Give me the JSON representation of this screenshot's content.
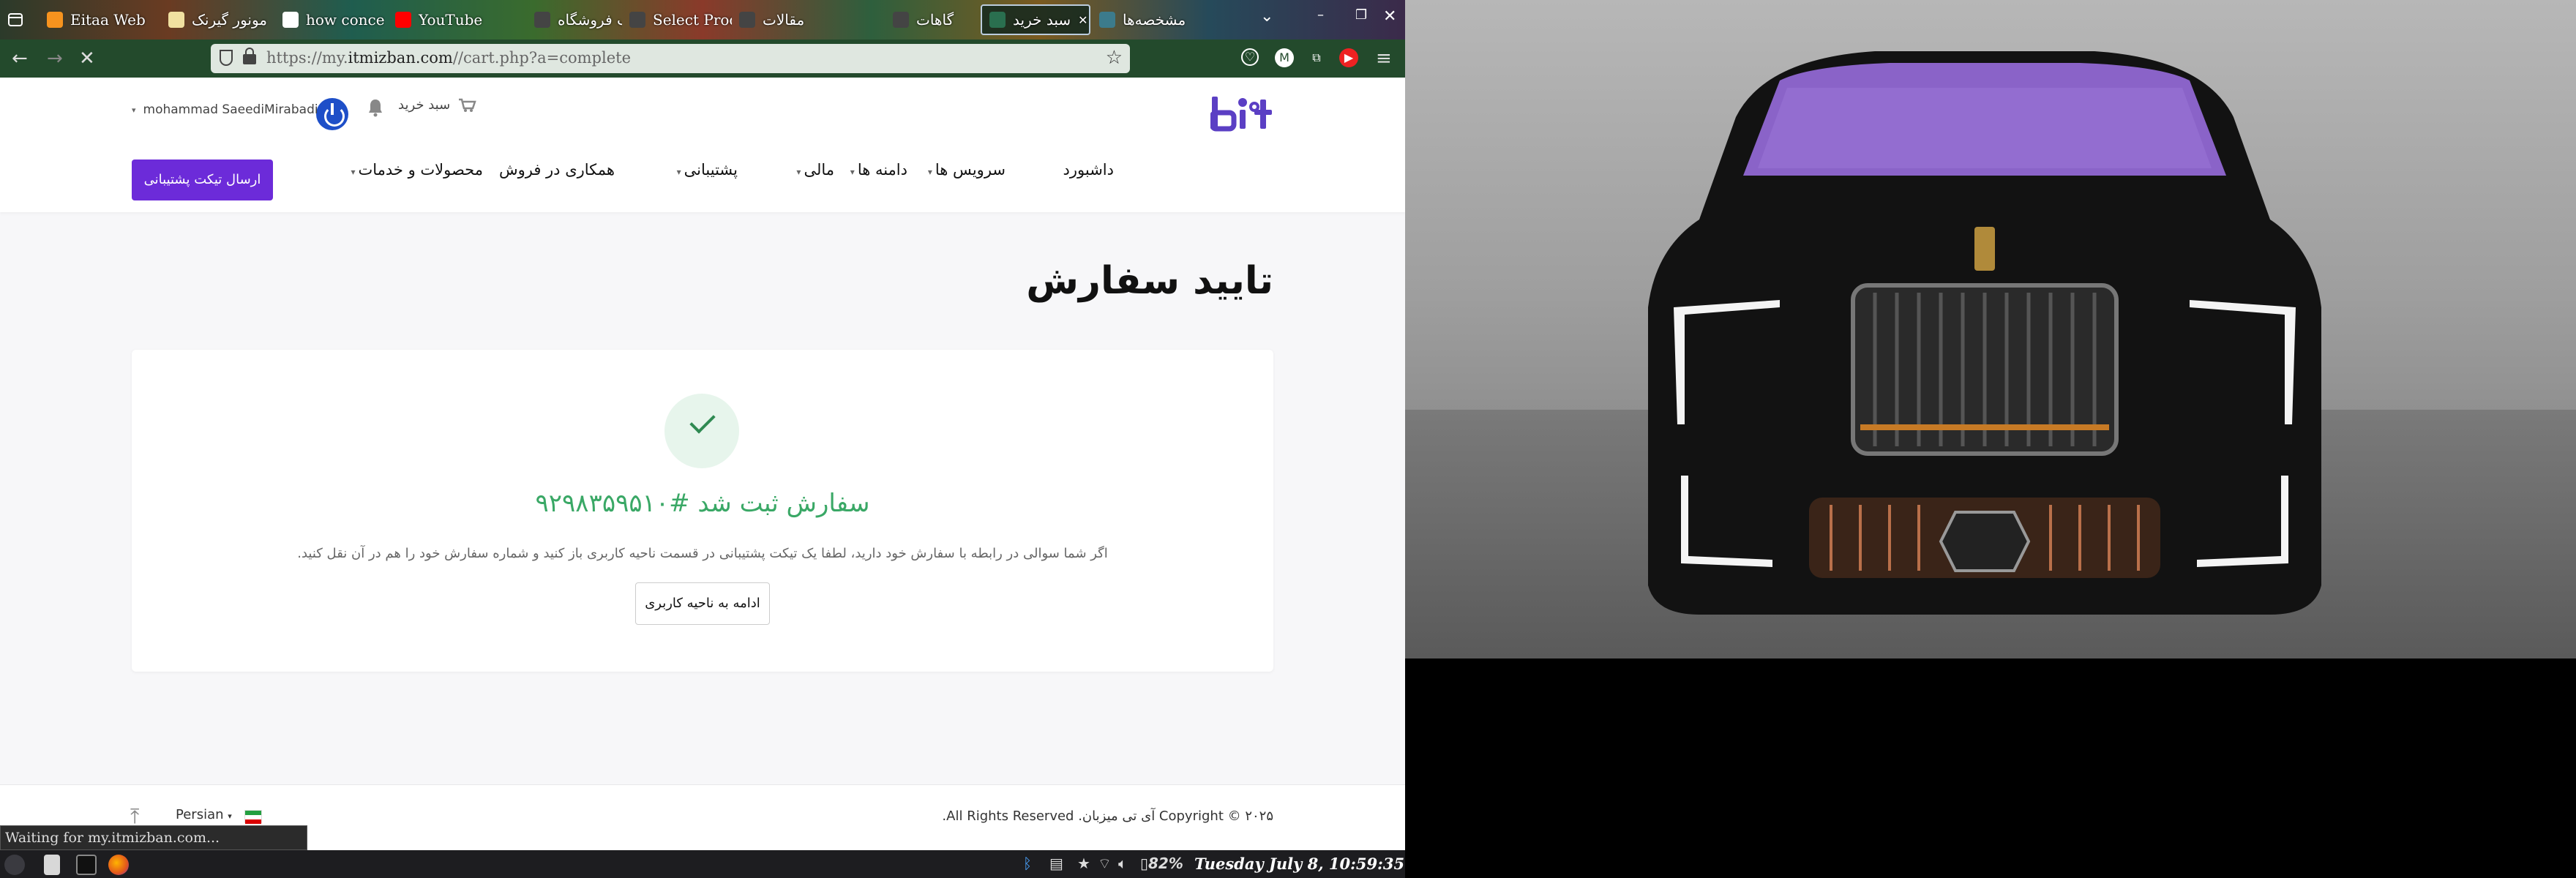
{
  "browser": {
    "tabs": [
      {
        "label": "Eitaa Web",
        "color": "#f7931e"
      },
      {
        "label": "مونور گیرنک",
        "color": "#f0e0a0"
      },
      {
        "label": "how conce",
        "color": "#ffffff"
      },
      {
        "label": "YouTube",
        "color": "#ff0000"
      },
      {
        "label": "قالب فروشگاه",
        "color": "#444444"
      },
      {
        "label": "Select Prod",
        "color": "#444444"
      },
      {
        "label": "مقالات",
        "color": "#444444"
      },
      {
        "label": "گاهات",
        "color": "#444444"
      },
      {
        "label": "سبد خرید",
        "color": "#2a6f4f",
        "active": true
      },
      {
        "label": "مشخصه‌ها",
        "color": "#3c7b8c"
      }
    ],
    "url_prefix": "https://my.",
    "url_domain": "itmizban.com",
    "url_path": "//cart.php?a=complete",
    "status_text": "Waiting for my.itmizban.com..."
  },
  "header": {
    "cart_label": "سبد خرید",
    "user_name": "mohammad SaeediMirabadi",
    "menu": [
      {
        "label": "داشبورد",
        "caret": false
      },
      {
        "label": "سرویس ها",
        "caret": true
      },
      {
        "label": "دامنه ها",
        "caret": true
      },
      {
        "label": "مالی",
        "caret": true
      },
      {
        "label": "پشتیبانی",
        "caret": true
      },
      {
        "label": "همکاری در فروش",
        "caret": false
      },
      {
        "label": "محصولات و خدمات",
        "caret": true
      }
    ],
    "ticket_button": "ارسال تیکت پشتیبانی"
  },
  "main": {
    "title": "تایید سفارش",
    "success_message": "سفارش ثبت شد #۹۲۹۸۳۵۹۵۱۰",
    "note": "اگر شما سوالی در رابطه با سفارش خود دارید، لطفا یک تیکت پشتیبانی در قسمت ناحیه کاربری باز کنید و شماره سفارش خود را هم در آن نقل کنید.",
    "continue_button": "ادامه به ناحیه کاربری"
  },
  "footer": {
    "copyright": "Copyright © ۲۰۲۵ آی تی میزبان. All Rights Reserved.",
    "language": "Persian"
  },
  "taskbar": {
    "battery": "82%",
    "clock": "Tuesday July   8, 10:59:35"
  },
  "colors": {
    "accent": "#6c2bd9",
    "success": "#3aa866",
    "logo": "#5b3fc4"
  }
}
